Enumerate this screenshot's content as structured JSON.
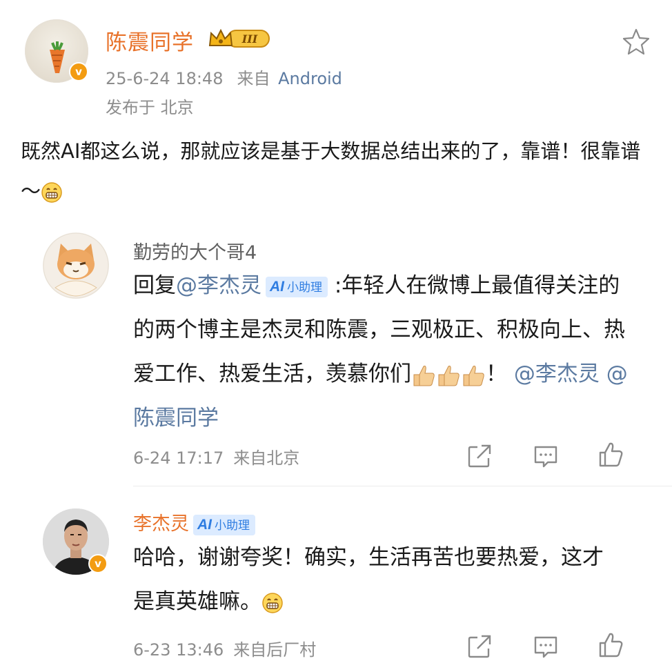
{
  "post": {
    "author": "陈震同学",
    "rank_badge": "III",
    "timestamp": "25-6-24 18:48",
    "source_prefix": "来自",
    "source": "Android",
    "location": "发布于 北京",
    "text": "既然AI都这么说，那就应该是基于大数据总结出来的了，靠谱！很靠谱～"
  },
  "replies": [
    {
      "author": "勤劳的大个哥4",
      "reply_prefix": "回复",
      "reply_to": "@李杰灵",
      "ai_tag_mark": "AI",
      "ai_tag_label": "小助理",
      "text": " :年轻人在微博上最值得关注的的两个博主是杰灵和陈震，三观极正、积极向上、热爱工作、热爱生活，羡慕你们",
      "text_tail": "！",
      "mention_1": "@李杰灵",
      "mention_2": "@陈震同学",
      "timestamp": "6-24 17:17",
      "source": "来自北京"
    },
    {
      "author": "李杰灵",
      "ai_tag_mark": "AI",
      "ai_tag_label": "小助理",
      "text": "哈哈，谢谢夸奖！确实，生活再苦也要热爱，这才是真英雄嘛。",
      "timestamp": "6-23 13:46",
      "source": "来自后厂村"
    }
  ],
  "icons": {
    "verified": "v",
    "favorite": "star-outline-icon",
    "share": "share-icon",
    "comment": "comment-icon",
    "like": "like-icon",
    "emoji_grin": "grin-emoji",
    "emoji_thumb": "thumbs-up-emoji"
  },
  "colors": {
    "author_orange": "#e8722a",
    "link_blue": "#5b7aa1",
    "meta_gray": "#8d8d8d",
    "ai_tag_bg": "#dcebff",
    "ai_tag_text": "#2f7de1",
    "verified_badge": "#f39c12"
  }
}
